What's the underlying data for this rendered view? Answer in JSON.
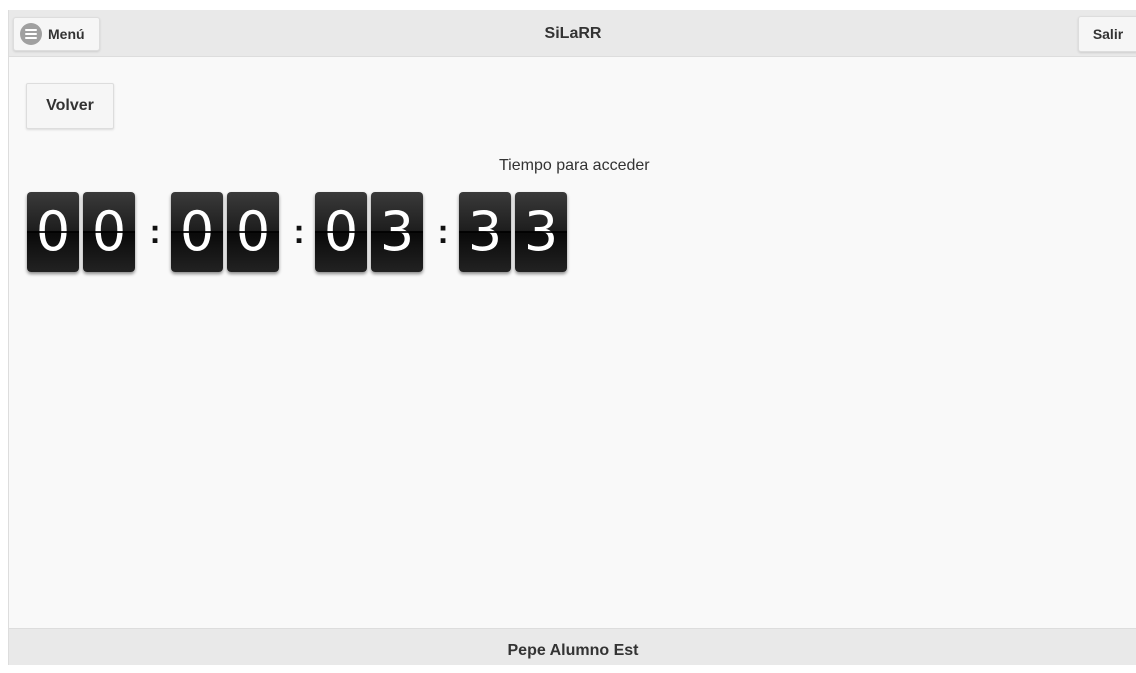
{
  "header": {
    "title": "SiLaRR",
    "menu_label": "Menú",
    "menu_icon": "bars-icon",
    "logout_label": "Salir"
  },
  "content": {
    "back_label": "Volver",
    "timer_label": "Tiempo para acceder",
    "countdown": {
      "days": [
        "0",
        "0"
      ],
      "hours": [
        "0",
        "0"
      ],
      "minutes": [
        "0",
        "3"
      ],
      "seconds": [
        "3",
        "3"
      ],
      "separator": ":"
    }
  },
  "footer": {
    "user_name": "Pepe Alumno Est"
  }
}
